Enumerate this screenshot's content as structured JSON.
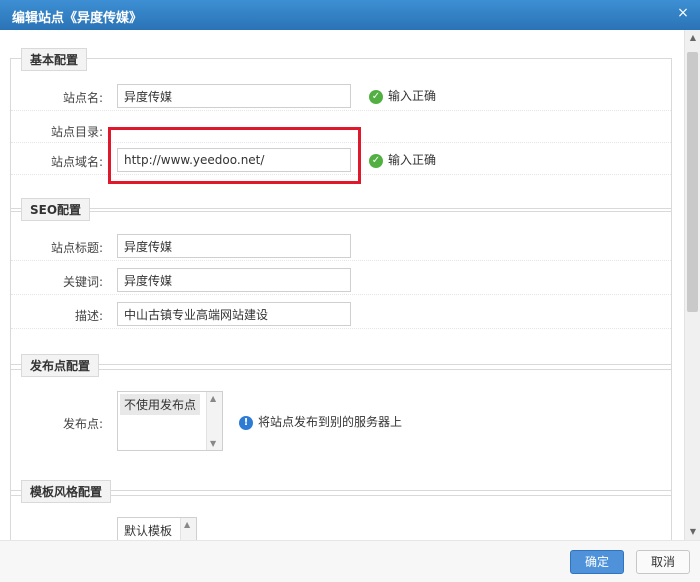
{
  "window": {
    "title": "编辑站点《异度传媒》",
    "close": "×"
  },
  "basic": {
    "legend": "基本配置",
    "site_name": {
      "label": "站点名:",
      "value": "异度传媒",
      "status": "输入正确"
    },
    "site_dir": {
      "label": "站点目录:"
    },
    "site_domain": {
      "label": "站点域名:",
      "value": "http://www.yeedoo.net/",
      "status": "输入正确"
    }
  },
  "seo": {
    "legend": "SEO配置",
    "title": {
      "label": "站点标题:",
      "value": "异度传媒"
    },
    "keywords": {
      "label": "关键词:",
      "value": "异度传媒"
    },
    "description": {
      "label": "描述:",
      "value": "中山古镇专业高端网站建设"
    }
  },
  "publish": {
    "legend": "发布点配置",
    "label": "发布点:",
    "option": "不使用发布点",
    "hint": "将站点发布到别的服务器上"
  },
  "template": {
    "legend": "模板风格配置",
    "option": "默认模板"
  },
  "footer": {
    "submit": "确定",
    "cancel": "取消"
  },
  "colors": {
    "titlebar": "#2a73b6",
    "ok": "#52b043",
    "highlight": "#e0182b",
    "primary": "#4f92d9"
  }
}
